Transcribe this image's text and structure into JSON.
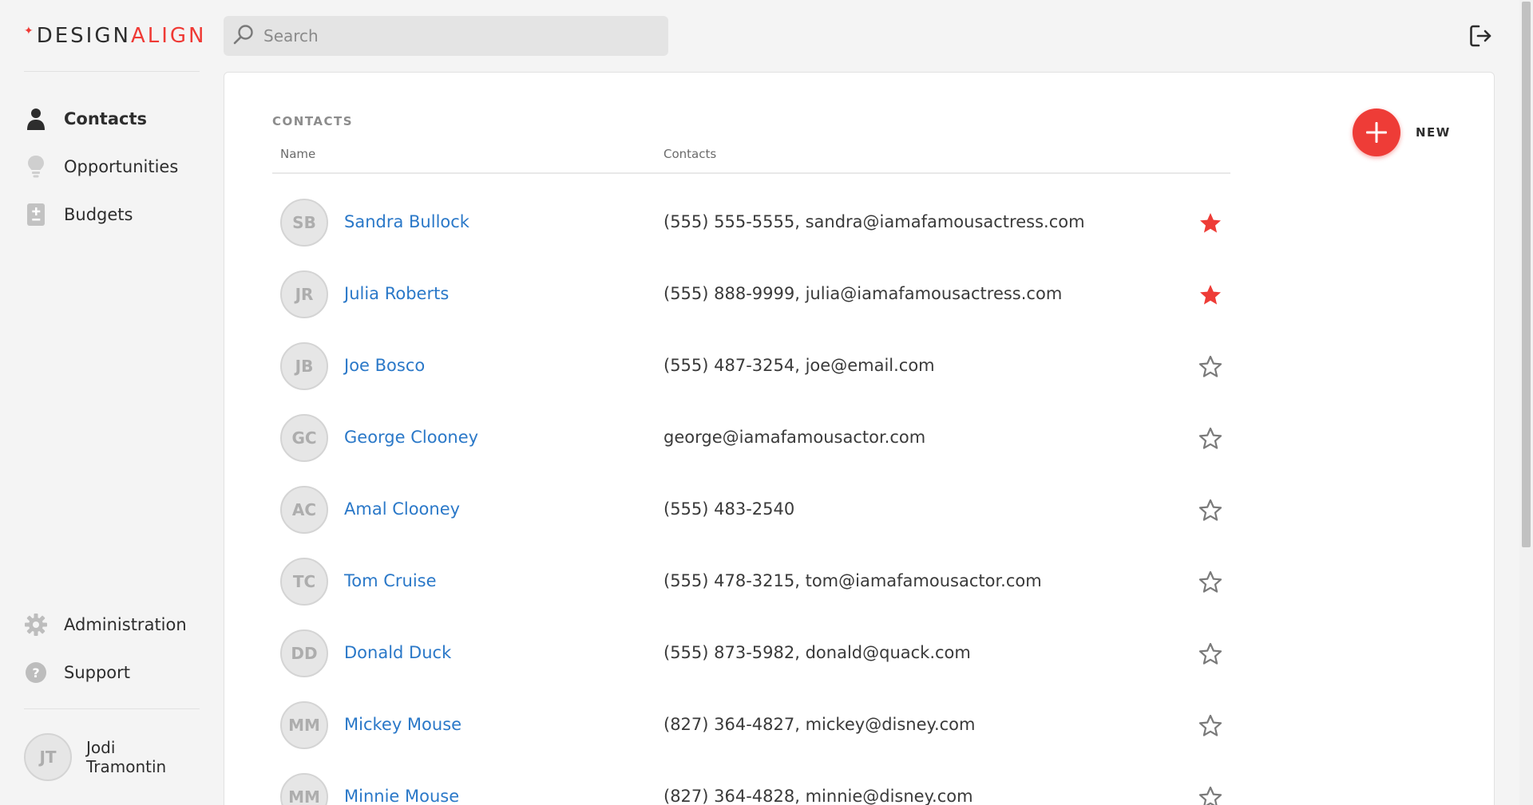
{
  "brand": {
    "part1": "DESIGN",
    "part2": "ALIGN",
    "accent": "#ef3a35"
  },
  "search": {
    "placeholder": "Search",
    "value": ""
  },
  "nav": {
    "main": [
      {
        "label": "Contacts",
        "icon": "person-icon",
        "active": true
      },
      {
        "label": "Opportunities",
        "icon": "lightbulb-icon",
        "active": false
      },
      {
        "label": "Budgets",
        "icon": "budget-icon",
        "active": false
      }
    ],
    "bottom": [
      {
        "label": "Administration",
        "icon": "gear-icon"
      },
      {
        "label": "Support",
        "icon": "help-icon"
      }
    ]
  },
  "user": {
    "initials": "JT",
    "name": "Jodi Tramontin"
  },
  "contacts": {
    "section_title": "CONTACTS",
    "new_label": "NEW",
    "columns": {
      "name": "Name",
      "contacts": "Contacts"
    },
    "rows": [
      {
        "initials": "SB",
        "name": "Sandra Bullock",
        "info": "(555) 555-5555, sandra@iamafamousactress.com",
        "starred": true
      },
      {
        "initials": "JR",
        "name": "Julia Roberts",
        "info": "(555) 888-9999, julia@iamafamousactress.com",
        "starred": true
      },
      {
        "initials": "JB",
        "name": "Joe Bosco",
        "info": "(555) 487-3254, joe@email.com",
        "starred": false
      },
      {
        "initials": "GC",
        "name": "George Clooney",
        "info": "george@iamafamousactor.com",
        "starred": false
      },
      {
        "initials": "AC",
        "name": "Amal Clooney",
        "info": "(555) 483-2540",
        "starred": false
      },
      {
        "initials": "TC",
        "name": "Tom Cruise",
        "info": "(555) 478-3215, tom@iamafamousactor.com",
        "starred": false
      },
      {
        "initials": "DD",
        "name": "Donald Duck",
        "info": "(555) 873-5982, donald@quack.com",
        "starred": false
      },
      {
        "initials": "MM",
        "name": "Mickey Mouse",
        "info": "(827) 364-4827, mickey@disney.com",
        "starred": false
      },
      {
        "initials": "MM",
        "name": "Minnie Mouse",
        "info": "(827) 364-4828, minnie@disney.com",
        "starred": false
      }
    ]
  },
  "colors": {
    "star_on": "#ee3c37",
    "star_off": "#7a7a7a",
    "link": "#2a78c8"
  }
}
